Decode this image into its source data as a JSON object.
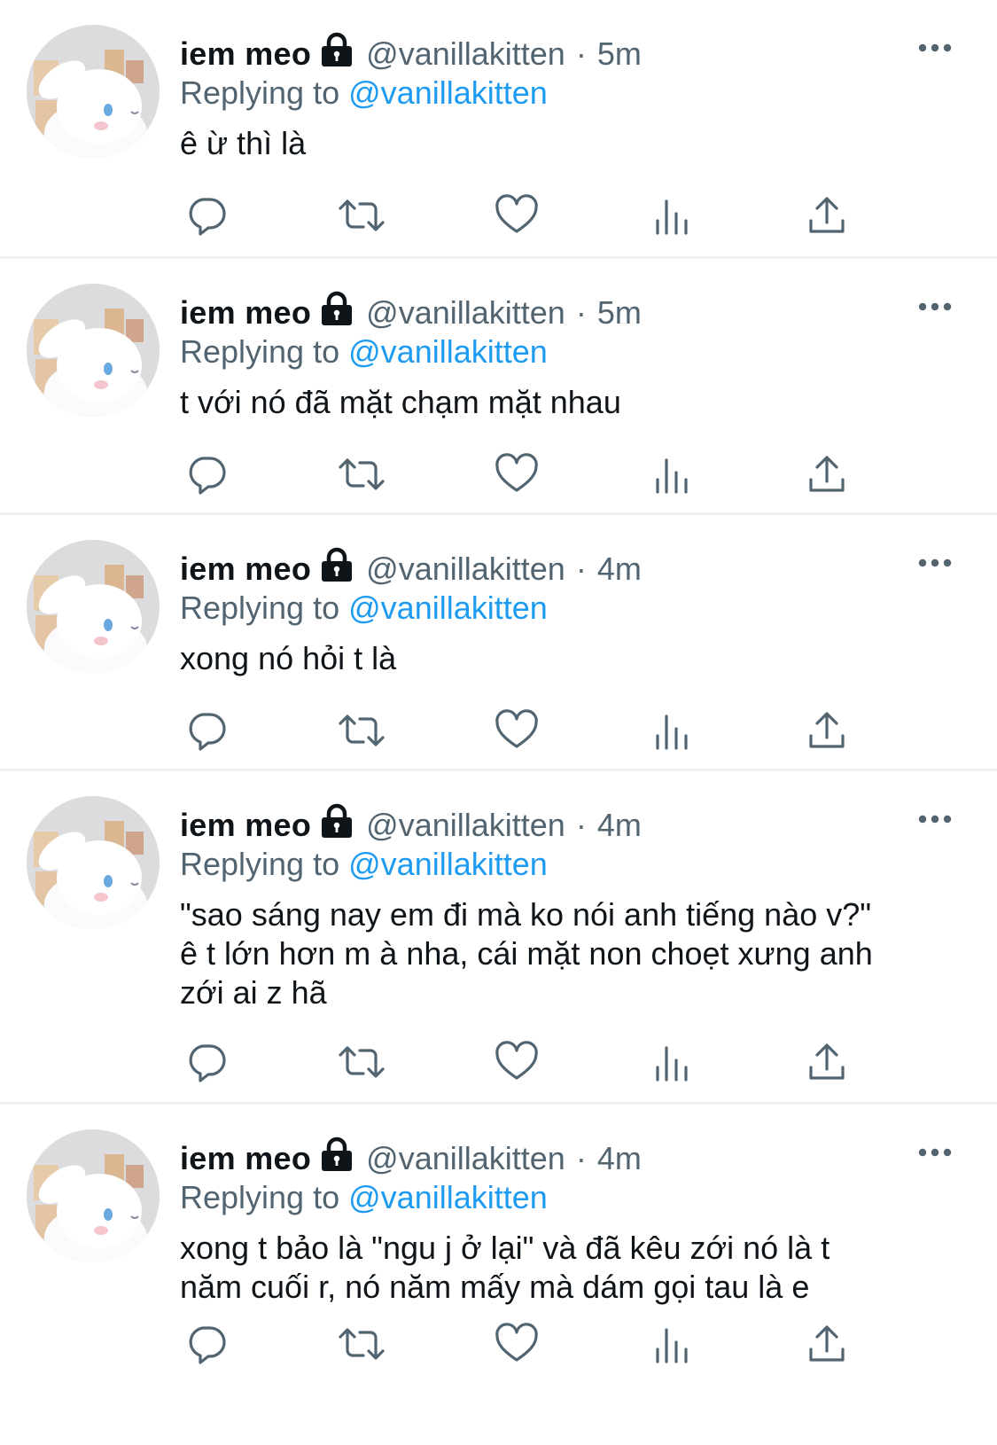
{
  "colors": {
    "text": "#0f1419",
    "secondary": "#536471",
    "accent": "#1d9bf0",
    "divider": "#eff3f4"
  },
  "tweets": [
    {
      "name": "iem meo",
      "handle": "@vanillakitten",
      "dot": "·",
      "time": "5m",
      "replying_label": "Replying to",
      "replying_to": "@vanillakitten",
      "text": "ê ừ thì là"
    },
    {
      "name": "iem meo",
      "handle": "@vanillakitten",
      "dot": "·",
      "time": "5m",
      "replying_label": "Replying to",
      "replying_to": "@vanillakitten",
      "text": "t với nó đã mặt chạm mặt nhau"
    },
    {
      "name": "iem meo",
      "handle": "@vanillakitten",
      "dot": "·",
      "time": "4m",
      "replying_label": "Replying to",
      "replying_to": "@vanillakitten",
      "text": "xong nó hỏi t là"
    },
    {
      "name": "iem meo",
      "handle": "@vanillakitten",
      "dot": "·",
      "time": "4m",
      "replying_label": "Replying to",
      "replying_to": "@vanillakitten",
      "text": "\"sao sáng nay em đi mà ko nói anh tiếng nào v?\"\nê t lớn hơn m à nha, cái mặt non choẹt xưng anh\nzới ai z hã"
    },
    {
      "name": "iem meo",
      "handle": "@vanillakitten",
      "dot": "·",
      "time": "4m",
      "replying_label": "Replying to",
      "replying_to": "@vanillakitten",
      "text": "xong t bảo là \"ngu j ở lại\" và đã kêu zới nó là t\nnăm cuối r, nó năm mấy mà dám gọi tau là e"
    }
  ],
  "icons": {
    "lock": "lock-icon",
    "more": "more-icon",
    "reply": "reply-icon",
    "retweet": "retweet-icon",
    "like": "like-icon",
    "views": "views-icon",
    "share": "share-icon"
  }
}
